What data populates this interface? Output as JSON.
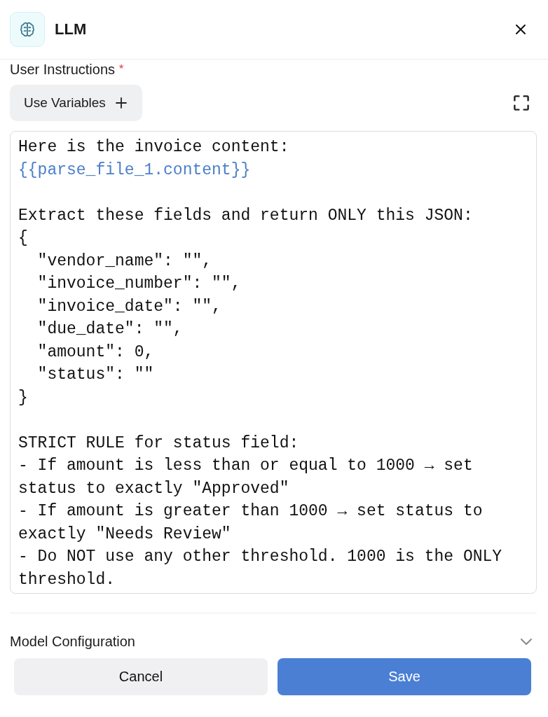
{
  "header": {
    "title": "LLM"
  },
  "field": {
    "label": "User Instructions",
    "required_mark": "*",
    "variables_button": "Use Variables",
    "lines": [
      {
        "kind": "plain",
        "text": "Here is the invoice content:"
      },
      {
        "kind": "variable",
        "text": "{{parse_file_1.content}}"
      },
      {
        "kind": "blank"
      },
      {
        "kind": "plain",
        "text": "Extract these fields and return ONLY this JSON:"
      },
      {
        "kind": "plain",
        "text": "{"
      },
      {
        "kind": "plain",
        "text": "  \"vendor_name\": \"\","
      },
      {
        "kind": "plain",
        "text": "  \"invoice_number\": \"\","
      },
      {
        "kind": "plain",
        "text": "  \"invoice_date\": \"\","
      },
      {
        "kind": "plain",
        "text": "  \"due_date\": \"\","
      },
      {
        "kind": "plain",
        "text": "  \"amount\": 0,"
      },
      {
        "kind": "plain",
        "text": "  \"status\": \"\""
      },
      {
        "kind": "plain",
        "text": "}"
      },
      {
        "kind": "blank"
      },
      {
        "kind": "plain",
        "text": "STRICT RULE for status field:"
      },
      {
        "kind": "plain",
        "text": "- If amount is less than or equal to 1000 → set status to exactly \"Approved\""
      },
      {
        "kind": "plain",
        "text": "- If amount is greater than 1000 → set status to exactly \"Needs Review\""
      },
      {
        "kind": "plain",
        "text": "- Do NOT use any other threshold. 1000 is the ONLY threshold."
      }
    ]
  },
  "section": {
    "title": "Model Configuration",
    "expanded": false
  },
  "buttons": [
    {
      "kind": "secondary",
      "label": "Cancel"
    },
    {
      "kind": "primary",
      "label": "Save"
    }
  ]
}
